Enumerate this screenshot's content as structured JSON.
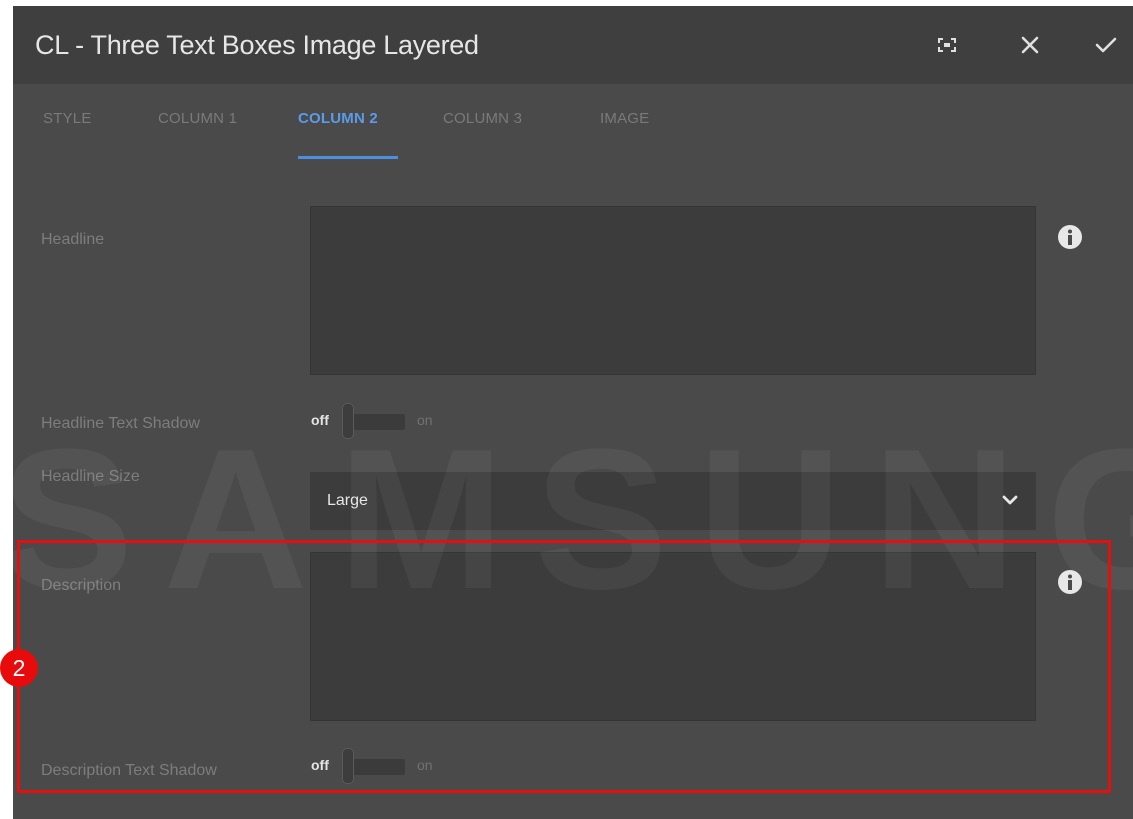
{
  "dialog": {
    "title": "CL - Three Text Boxes Image Layered",
    "icons": {
      "fullscreen": "fullscreen-icon",
      "close": "close-icon",
      "confirm": "checkmark-icon"
    }
  },
  "tabs": [
    {
      "label": "STYLE",
      "active": false
    },
    {
      "label": "COLUMN 1",
      "active": false
    },
    {
      "label": "COLUMN 2",
      "active": true
    },
    {
      "label": "COLUMN 3",
      "active": false
    },
    {
      "label": "IMAGE",
      "active": false
    }
  ],
  "form": {
    "headline": {
      "label": "Headline",
      "value": ""
    },
    "headline_text_shadow": {
      "label": "Headline Text Shadow",
      "off": "off",
      "on": "on",
      "state": "off"
    },
    "headline_size": {
      "label": "Headline Size",
      "value": "Large"
    },
    "description": {
      "label": "Description",
      "value": ""
    },
    "description_text_shadow": {
      "label": "Description Text Shadow",
      "off": "off",
      "on": "on",
      "state": "off"
    }
  },
  "watermark": "SAMSUNG",
  "annotation": {
    "badge": "2"
  },
  "colors": {
    "accent": "#4c8ee0",
    "highlight": "#e31010",
    "panel": "#4a4a4a"
  }
}
